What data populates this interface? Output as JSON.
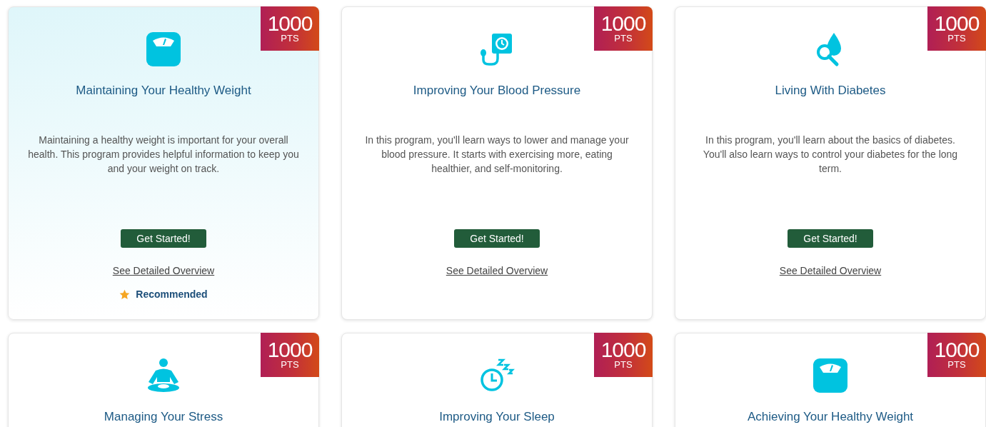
{
  "cards": [
    {
      "kind": "scale",
      "points": "1000",
      "points_unit": "PTS",
      "title": "Maintaining Your Healthy Weight",
      "description": "Maintaining a healthy weight is important for your overall health. This program provides helpful information to keep you and your weight on track.",
      "button": "Get Started!",
      "link": "See Detailed Overview",
      "recommended": true,
      "recommended_label": "Recommended"
    },
    {
      "kind": "blood-pressure",
      "points": "1000",
      "points_unit": "PTS",
      "title": "Improving Your Blood Pressure",
      "description": "In this program, you'll learn ways to lower and manage your blood pressure. It starts with exercising more, eating healthier, and self-monitoring.",
      "button": "Get Started!",
      "link": "See Detailed Overview",
      "recommended": false
    },
    {
      "kind": "drop-search",
      "points": "1000",
      "points_unit": "PTS",
      "title": "Living With Diabetes",
      "description": "In this program, you'll learn about the basics of diabetes. You'll also learn ways to control your diabetes for the long term.",
      "button": "Get Started!",
      "link": "See Detailed Overview",
      "recommended": false
    },
    {
      "kind": "meditation",
      "points": "1000",
      "points_unit": "PTS",
      "title": "Managing Your Stress"
    },
    {
      "kind": "sleep",
      "points": "1000",
      "points_unit": "PTS",
      "title": "Improving Your Sleep"
    },
    {
      "kind": "scale",
      "points": "1000",
      "points_unit": "PTS",
      "title": "Achieving Your Healthy Weight"
    }
  ]
}
